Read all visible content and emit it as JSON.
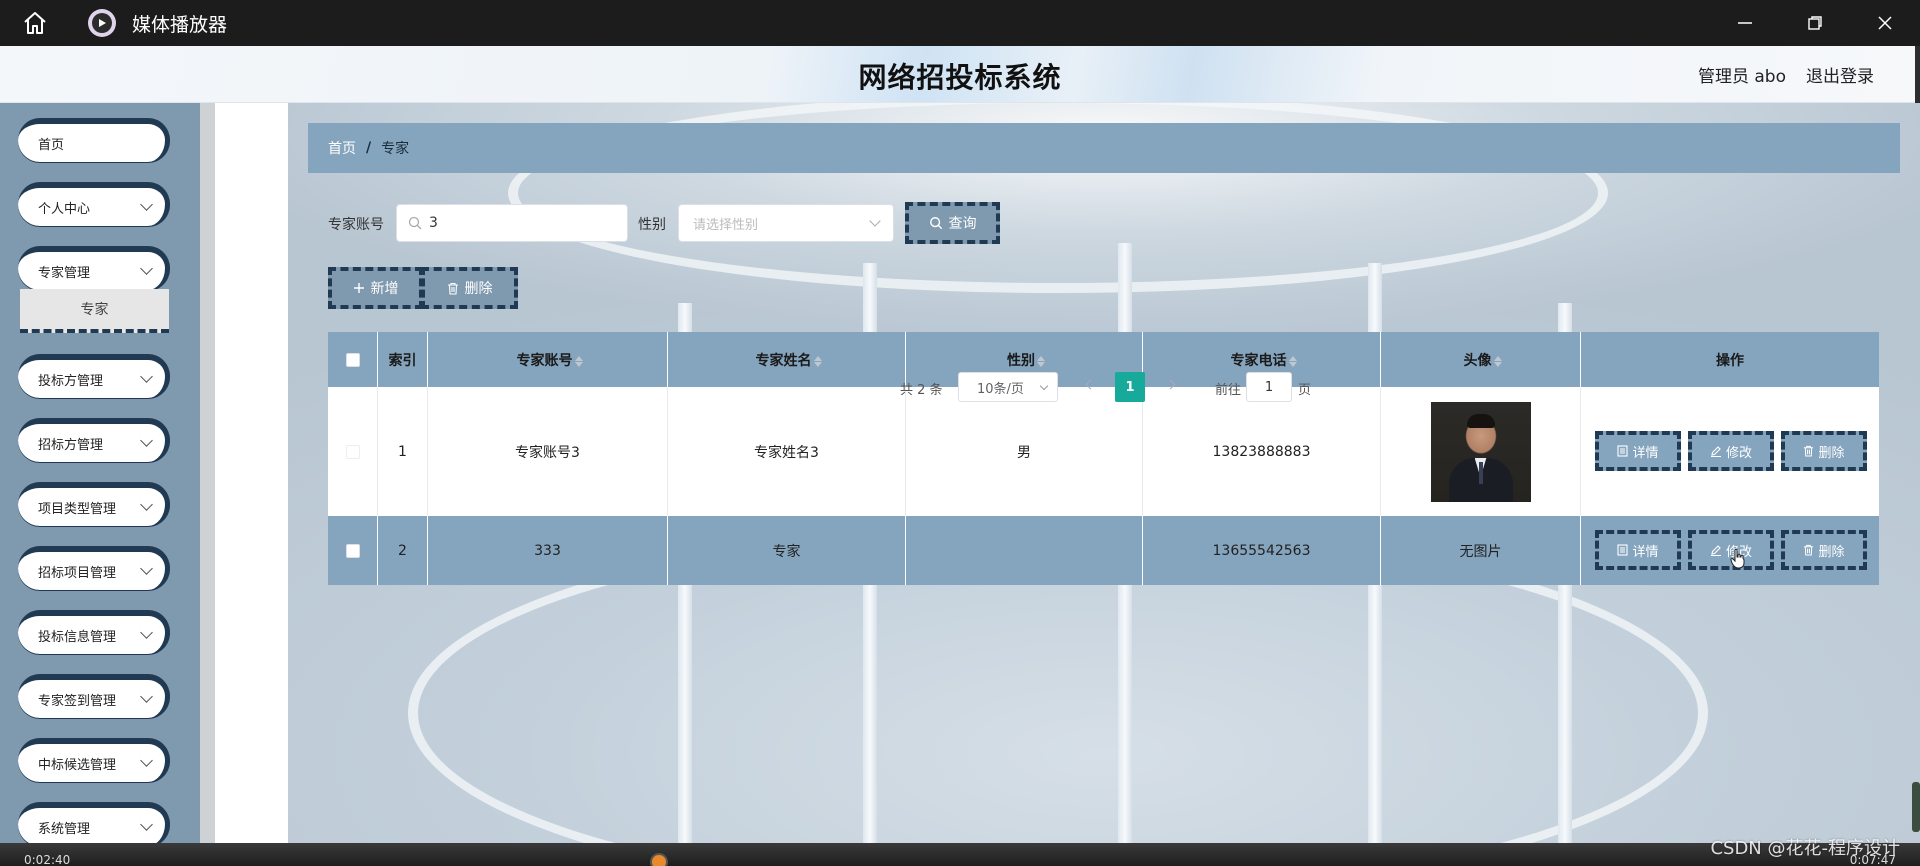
{
  "titlebar": {
    "app_title": "媒体播放器"
  },
  "header": {
    "system_title": "网络招投标系统",
    "user": "管理员 abo",
    "logout": "退出登录"
  },
  "sidebar": {
    "items": [
      {
        "label": "首页",
        "has_chevron": false
      },
      {
        "label": "个人中心",
        "has_chevron": true
      },
      {
        "label": "专家管理",
        "has_chevron": true
      },
      {
        "label": "投标方管理",
        "has_chevron": true
      },
      {
        "label": "招标方管理",
        "has_chevron": true
      },
      {
        "label": "项目类型管理",
        "has_chevron": true
      },
      {
        "label": "招标项目管理",
        "has_chevron": true
      },
      {
        "label": "投标信息管理",
        "has_chevron": true
      },
      {
        "label": "专家签到管理",
        "has_chevron": true
      },
      {
        "label": "中标候选管理",
        "has_chevron": true
      },
      {
        "label": "系统管理",
        "has_chevron": true
      }
    ],
    "submenu_active": "专家"
  },
  "breadcrumb": {
    "home": "首页",
    "separator": "/",
    "current": "专家"
  },
  "search": {
    "account_label": "专家账号",
    "account_value": "3",
    "gender_label": "性别",
    "gender_placeholder": "请选择性别",
    "query_button": "查询"
  },
  "actions": {
    "add": "新增",
    "delete": "删除"
  },
  "table": {
    "headers": [
      "索引",
      "专家账号",
      "专家姓名",
      "性别",
      "专家电话",
      "头像",
      "操作"
    ],
    "rows": [
      {
        "index": "1",
        "account": "专家账号3",
        "name": "专家姓名3",
        "gender": "男",
        "phone": "13823888883",
        "avatar": "photo"
      },
      {
        "index": "2",
        "account": "333",
        "name": "专家",
        "gender": "",
        "phone": "13655542563",
        "avatar_text": "无图片"
      }
    ],
    "row_buttons": {
      "detail": "详情",
      "edit": "修改",
      "delete": "删除"
    }
  },
  "pagination": {
    "total": "共 2 条",
    "page_size": "10条/页",
    "current_page": "1",
    "goto_label": "前往",
    "goto_value": "1",
    "page_suffix": "页"
  },
  "player": {
    "elapsed": "0:02:40",
    "duration": "0:07:47"
  },
  "watermark": "CSDN @花花-程序设计",
  "colors": {
    "accent": "#85a4bd",
    "sidebar": "#7f99ae",
    "dark_border": "#1f3a52",
    "page_active": "#17a999"
  }
}
